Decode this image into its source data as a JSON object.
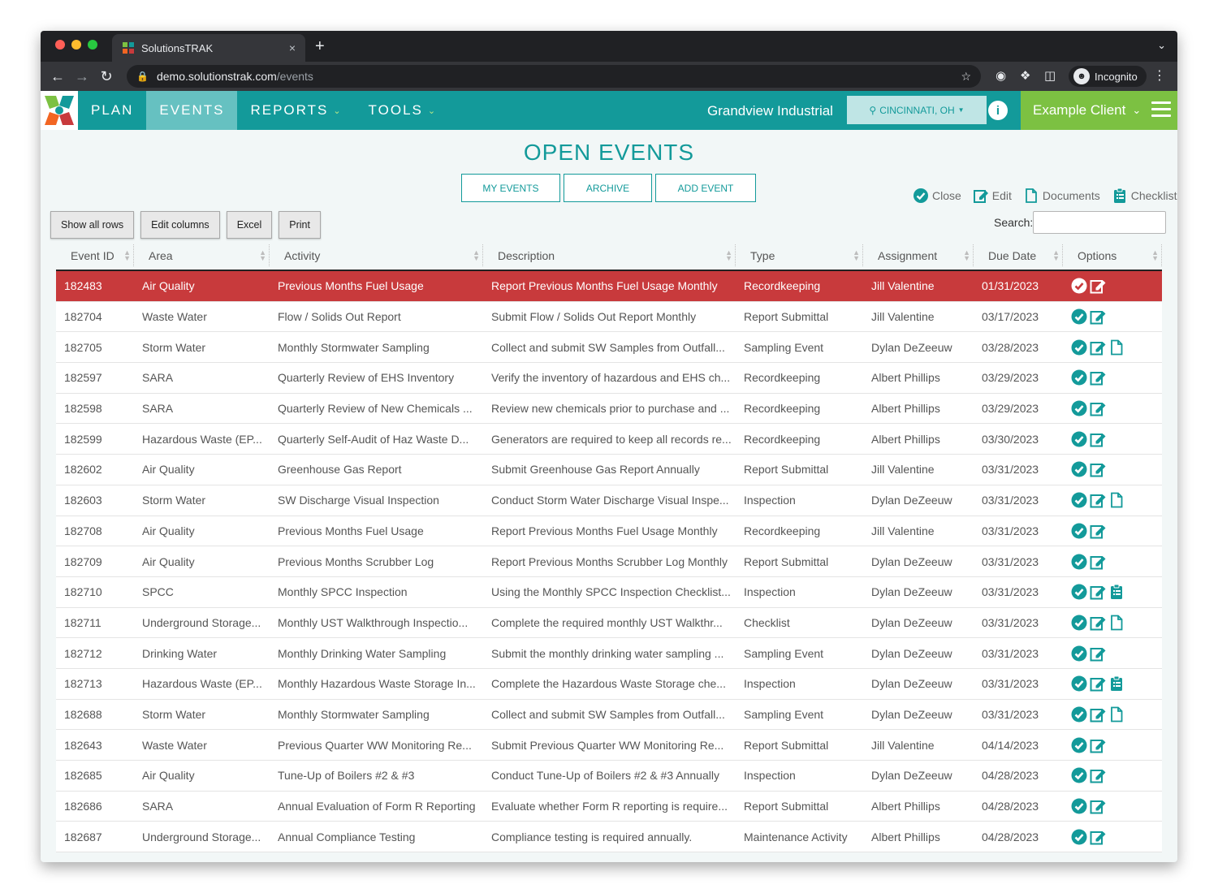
{
  "browser": {
    "tab_title": "SolutionsTRAK",
    "tab_close": "×",
    "new_tab": "+",
    "url_host": "demo.solutionstrak.com",
    "url_path": "/events",
    "profile": "Incognito"
  },
  "nav": {
    "items": [
      "PLAN",
      "EVENTS",
      "REPORTS",
      "TOOLS"
    ],
    "client_name": "Grandview Industrial",
    "location": "CINCINNATI, OH",
    "info": "i",
    "client_select": "Example Client"
  },
  "page": {
    "title": "OPEN EVENTS",
    "buttons": [
      "MY EVENTS",
      "ARCHIVE",
      "ADD EVENT"
    ],
    "legend": [
      "Close",
      "Edit",
      "Documents",
      "Checklist"
    ],
    "toolbar": [
      "Show all rows",
      "Edit columns",
      "Excel",
      "Print"
    ],
    "search_label": "Search:"
  },
  "colors": {
    "teal": "#139a9a",
    "light_teal": "#66c1c1",
    "green": "#7cc142",
    "overdue": "#c83a3c"
  },
  "table": {
    "columns": [
      "Event ID",
      "Area",
      "Activity",
      "Description",
      "Type",
      "Assignment",
      "Due Date",
      "Options"
    ],
    "rows": [
      {
        "id": "182483",
        "area": "Air Quality",
        "activity": "Previous Months Fuel Usage",
        "description": "Report Previous Months Fuel Usage Monthly",
        "type": "Recordkeeping",
        "assignment": "Jill Valentine",
        "due": "01/31/2023",
        "icons": [
          "close",
          "edit"
        ],
        "overdue": true
      },
      {
        "id": "182704",
        "area": "Waste Water",
        "activity": "Flow / Solids Out Report",
        "description": "Submit Flow / Solids Out Report Monthly",
        "type": "Report Submittal",
        "assignment": "Jill Valentine",
        "due": "03/17/2023",
        "icons": [
          "close",
          "edit"
        ]
      },
      {
        "id": "182705",
        "area": "Storm Water",
        "activity": "Monthly Stormwater Sampling",
        "description": "Collect and submit SW Samples from Outfall...",
        "type": "Sampling Event",
        "assignment": "Dylan DeZeeuw",
        "due": "03/28/2023",
        "icons": [
          "close",
          "edit",
          "documents"
        ]
      },
      {
        "id": "182597",
        "area": "SARA",
        "activity": "Quarterly Review of EHS Inventory",
        "description": "Verify the inventory of hazardous and EHS ch...",
        "type": "Recordkeeping",
        "assignment": "Albert Phillips",
        "due": "03/29/2023",
        "icons": [
          "close",
          "edit"
        ]
      },
      {
        "id": "182598",
        "area": "SARA",
        "activity": "Quarterly Review of New Chemicals ...",
        "description": "Review new chemicals prior to purchase and ...",
        "type": "Recordkeeping",
        "assignment": "Albert Phillips",
        "due": "03/29/2023",
        "icons": [
          "close",
          "edit"
        ]
      },
      {
        "id": "182599",
        "area": "Hazardous Waste (EP...",
        "activity": "Quarterly Self-Audit of Haz Waste D...",
        "description": "Generators are required to keep all records re...",
        "type": "Recordkeeping",
        "assignment": "Albert Phillips",
        "due": "03/30/2023",
        "icons": [
          "close",
          "edit"
        ]
      },
      {
        "id": "182602",
        "area": "Air Quality",
        "activity": "Greenhouse Gas Report",
        "description": "Submit Greenhouse Gas Report Annually",
        "type": "Report Submittal",
        "assignment": "Jill Valentine",
        "due": "03/31/2023",
        "icons": [
          "close",
          "edit"
        ]
      },
      {
        "id": "182603",
        "area": "Storm Water",
        "activity": "SW Discharge Visual Inspection",
        "description": "Conduct Storm Water Discharge Visual Inspe...",
        "type": "Inspection",
        "assignment": "Dylan DeZeeuw",
        "due": "03/31/2023",
        "icons": [
          "close",
          "edit",
          "documents"
        ]
      },
      {
        "id": "182708",
        "area": "Air Quality",
        "activity": "Previous Months Fuel Usage",
        "description": "Report Previous Months Fuel Usage Monthly",
        "type": "Recordkeeping",
        "assignment": "Jill Valentine",
        "due": "03/31/2023",
        "icons": [
          "close",
          "edit"
        ]
      },
      {
        "id": "182709",
        "area": "Air Quality",
        "activity": "Previous Months Scrubber Log",
        "description": "Report Previous Months Scrubber Log Monthly",
        "type": "Report Submittal",
        "assignment": "Dylan DeZeeuw",
        "due": "03/31/2023",
        "icons": [
          "close",
          "edit"
        ]
      },
      {
        "id": "182710",
        "area": "SPCC",
        "activity": "Monthly SPCC Inspection",
        "description": "Using the Monthly SPCC Inspection Checklist...",
        "type": "Inspection",
        "assignment": "Dylan DeZeeuw",
        "due": "03/31/2023",
        "icons": [
          "close",
          "edit",
          "checklist"
        ]
      },
      {
        "id": "182711",
        "area": "Underground Storage...",
        "activity": "Monthly UST Walkthrough Inspectio...",
        "description": "Complete the required monthly UST Walkthr...",
        "type": "Checklist",
        "assignment": "Dylan DeZeeuw",
        "due": "03/31/2023",
        "icons": [
          "close",
          "edit",
          "documents"
        ]
      },
      {
        "id": "182712",
        "area": "Drinking Water",
        "activity": "Monthly Drinking Water Sampling",
        "description": "Submit the monthly drinking water sampling ...",
        "type": "Sampling Event",
        "assignment": "Dylan DeZeeuw",
        "due": "03/31/2023",
        "icons": [
          "close",
          "edit"
        ]
      },
      {
        "id": "182713",
        "area": "Hazardous Waste (EP...",
        "activity": "Monthly Hazardous Waste Storage In...",
        "description": "Complete the Hazardous Waste Storage che...",
        "type": "Inspection",
        "assignment": "Dylan DeZeeuw",
        "due": "03/31/2023",
        "icons": [
          "close",
          "edit",
          "checklist"
        ]
      },
      {
        "id": "182688",
        "area": "Storm Water",
        "activity": "Monthly Stormwater Sampling",
        "description": "Collect and submit SW Samples from Outfall...",
        "type": "Sampling Event",
        "assignment": "Dylan DeZeeuw",
        "due": "03/31/2023",
        "icons": [
          "close",
          "edit",
          "documents"
        ]
      },
      {
        "id": "182643",
        "area": "Waste Water",
        "activity": "Previous Quarter WW Monitoring Re...",
        "description": "Submit Previous Quarter WW Monitoring Re...",
        "type": "Report Submittal",
        "assignment": "Jill Valentine",
        "due": "04/14/2023",
        "icons": [
          "close",
          "edit"
        ]
      },
      {
        "id": "182685",
        "area": "Air Quality",
        "activity": "Tune-Up of Boilers #2 & #3",
        "description": "Conduct Tune-Up of Boilers #2 & #3 Annually",
        "type": "Inspection",
        "assignment": "Dylan DeZeeuw",
        "due": "04/28/2023",
        "icons": [
          "close",
          "edit"
        ]
      },
      {
        "id": "182686",
        "area": "SARA",
        "activity": "Annual Evaluation of Form R Reporting",
        "description": "Evaluate whether Form R reporting is require...",
        "type": "Report Submittal",
        "assignment": "Albert Phillips",
        "due": "04/28/2023",
        "icons": [
          "close",
          "edit"
        ]
      },
      {
        "id": "182687",
        "area": "Underground Storage...",
        "activity": "Annual Compliance Testing",
        "description": "Compliance testing is required annually.",
        "type": "Maintenance Activity",
        "assignment": "Albert Phillips",
        "due": "04/28/2023",
        "icons": [
          "close",
          "edit"
        ]
      }
    ]
  }
}
